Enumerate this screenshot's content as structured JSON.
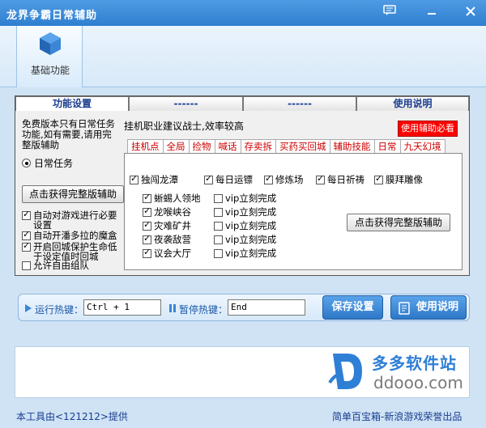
{
  "window": {
    "title": "龙界争霸日常辅助",
    "accent": "#2f7fd0"
  },
  "toolbar": {
    "item_label": "基础功能",
    "item_icon": "cube-icon"
  },
  "tabs": [
    "功能设置",
    "------",
    "------",
    "使用说明"
  ],
  "left": {
    "note": "免费版本只有日常任务功能,如有需要,请用完整版辅助",
    "radio_label": "日常任务",
    "get_full_button": "点击获得完整版辅助",
    "checks": [
      {
        "label": "自动对游戏进行必要设置",
        "checked": true
      },
      {
        "label": "自动开潘多拉的魔盒",
        "checked": true
      },
      {
        "label": "开启回城保护生命低于设定值时回城",
        "checked": true
      },
      {
        "label": "允许自由组队",
        "checked": false
      }
    ]
  },
  "info_text": "挂机职业建议战士,效率较高",
  "must_read_button": "使用辅助必看",
  "subtabs": [
    "挂机点",
    "全局",
    "捡物",
    "喊话",
    "存卖拆",
    "买药买回城",
    "辅助技能",
    "日常",
    "九天幻境"
  ],
  "active_subtab": "日常",
  "daily_top": [
    {
      "label": "独闯龙潭",
      "checked": true
    },
    {
      "label": "每日运镖",
      "checked": true
    },
    {
      "label": "修炼场",
      "checked": true
    },
    {
      "label": "每日祈祷",
      "checked": true
    },
    {
      "label": "膜拜雕像",
      "checked": true
    }
  ],
  "daily_list": [
    {
      "label": "蜥蜴人领地",
      "checked": true,
      "vip": "vip立刻完成",
      "vip_checked": false
    },
    {
      "label": "龙喉峡谷",
      "checked": true,
      "vip": "vip立刻完成",
      "vip_checked": false
    },
    {
      "label": "灾难矿井",
      "checked": true,
      "vip": "vip立刻完成",
      "vip_checked": false
    },
    {
      "label": "夜袭敌营",
      "checked": true,
      "vip": "vip立刻完成",
      "vip_checked": false
    },
    {
      "label": "议会大厅",
      "checked": true,
      "vip": "vip立刻完成",
      "vip_checked": false
    }
  ],
  "sub_get_full_button": "点击获得完整版辅助",
  "hotkeys": {
    "run_label": "运行热键：",
    "run_value": "Ctrl + 1",
    "pause_label": "暂停热键：",
    "pause_value": "End"
  },
  "save_button": "保存设置",
  "help_button": "使用说明",
  "watermark": {
    "name": "多多软件站",
    "url": "ddooo.com"
  },
  "footer": {
    "left": "本工具由<121212>提供",
    "right": "简单百宝箱-新浪游戏荣誉出品"
  }
}
